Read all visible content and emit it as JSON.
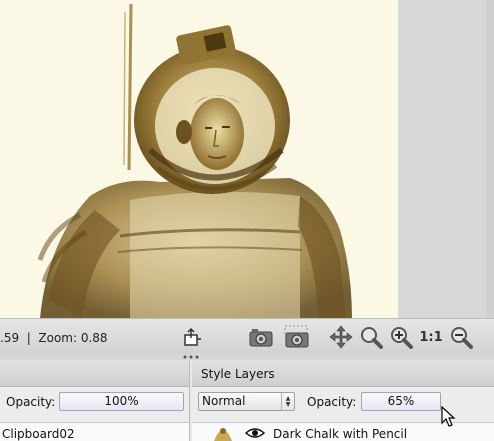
{
  "status": {
    "text": ".59  |  Zoom: 0.88"
  },
  "toolbar": {
    "tools": [
      "export-icon",
      "camera-icon",
      "camera-alt-icon",
      "pan-icon",
      "zoom-icon",
      "zoom-in-icon",
      "zoom-actual-icon",
      "zoom-out-icon"
    ],
    "actual_size_label": "1:1"
  },
  "left_panel": {
    "opacity_label": "Opacity:",
    "opacity_value": "100%",
    "item_label": "Clipboard02"
  },
  "style_layers": {
    "title": "Style Layers",
    "blend_mode": "Normal",
    "opacity_label": "Opacity:",
    "opacity_value": "65%",
    "layer_name": "Dark Chalk with Pencil"
  }
}
